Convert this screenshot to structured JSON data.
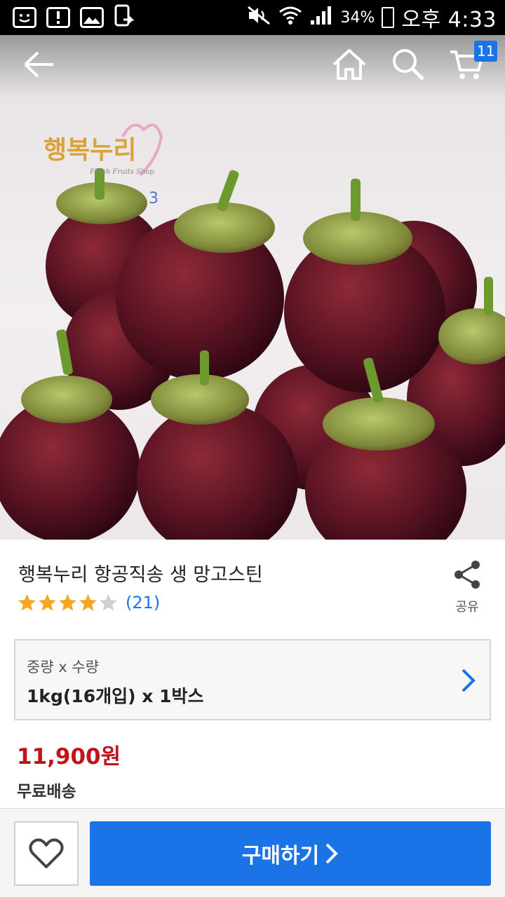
{
  "status_bar": {
    "battery": "34%",
    "time": "오후 4:33"
  },
  "nav": {
    "cart_count": "11"
  },
  "hero": {
    "logo_text": "행복누리",
    "logo_number": "3",
    "logo_tagline": "Fresh Fruits Shop"
  },
  "product": {
    "title": "행복누리 항공직송 생 망고스틴",
    "rating_stars": 4,
    "rating_max": 5,
    "rating_count": "(21)",
    "share_label": "공유"
  },
  "option": {
    "label": "중량 x 수량",
    "value": "1kg(16개입) x 1박스"
  },
  "price": "11,900원",
  "shipping": "무료배송",
  "bottom": {
    "buy_label": "구매하기"
  },
  "colors": {
    "accent": "#1b73e8",
    "price": "#c0141b",
    "star": "#f5a623",
    "star_empty": "#d0d0d0"
  }
}
